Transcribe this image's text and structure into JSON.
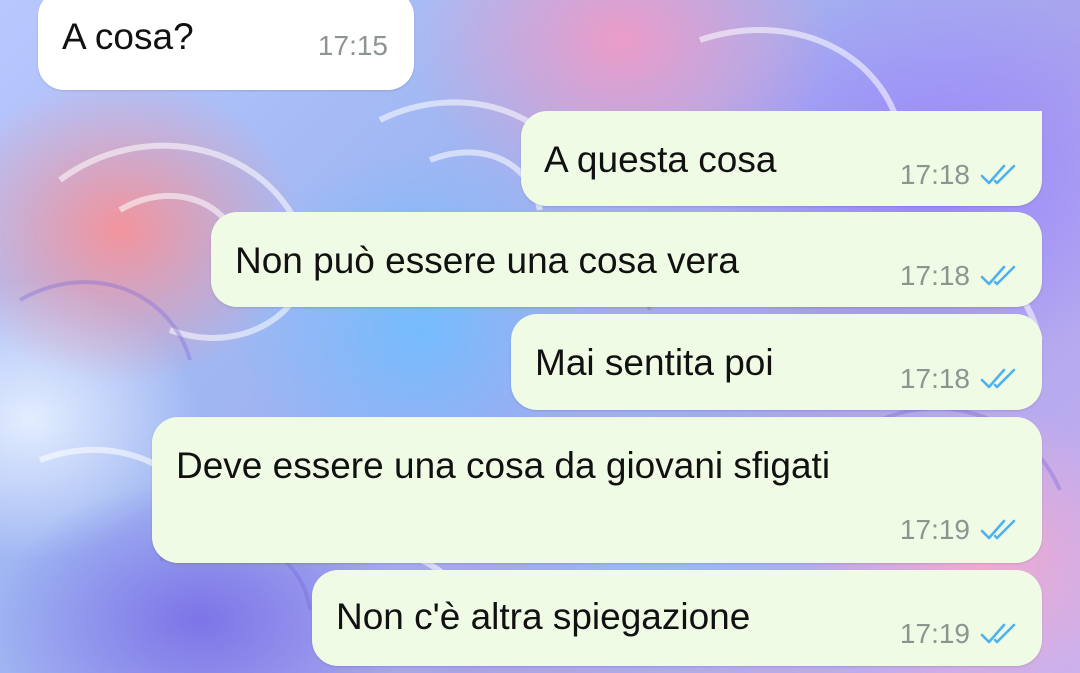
{
  "chat": {
    "messages": [
      {
        "direction": "incoming",
        "text": "A cosa?",
        "time": "17:15"
      },
      {
        "direction": "outgoing",
        "text": "A questa cosa",
        "time": "17:18",
        "status": "read-double-check-icon"
      },
      {
        "direction": "outgoing",
        "text": "Non può essere una cosa vera",
        "time": "17:18",
        "status": "read-double-check-icon"
      },
      {
        "direction": "outgoing",
        "text": "Mai sentita poi",
        "time": "17:18",
        "status": "read-double-check-icon"
      },
      {
        "direction": "outgoing",
        "text": "Deve essere una cosa da giovani sfigati",
        "time": "17:19",
        "status": "read-double-check-icon"
      },
      {
        "direction": "outgoing",
        "text": "Non c'è altra spiegazione",
        "time": "17:19",
        "status": "read-double-check-icon"
      }
    ]
  },
  "colors": {
    "incoming_bubble": "#ffffff",
    "outgoing_bubble": "#effbe4",
    "read_ticks": "#4fb1f0",
    "timestamp": "#8c9590",
    "wallpaper": "pastel-roses"
  }
}
